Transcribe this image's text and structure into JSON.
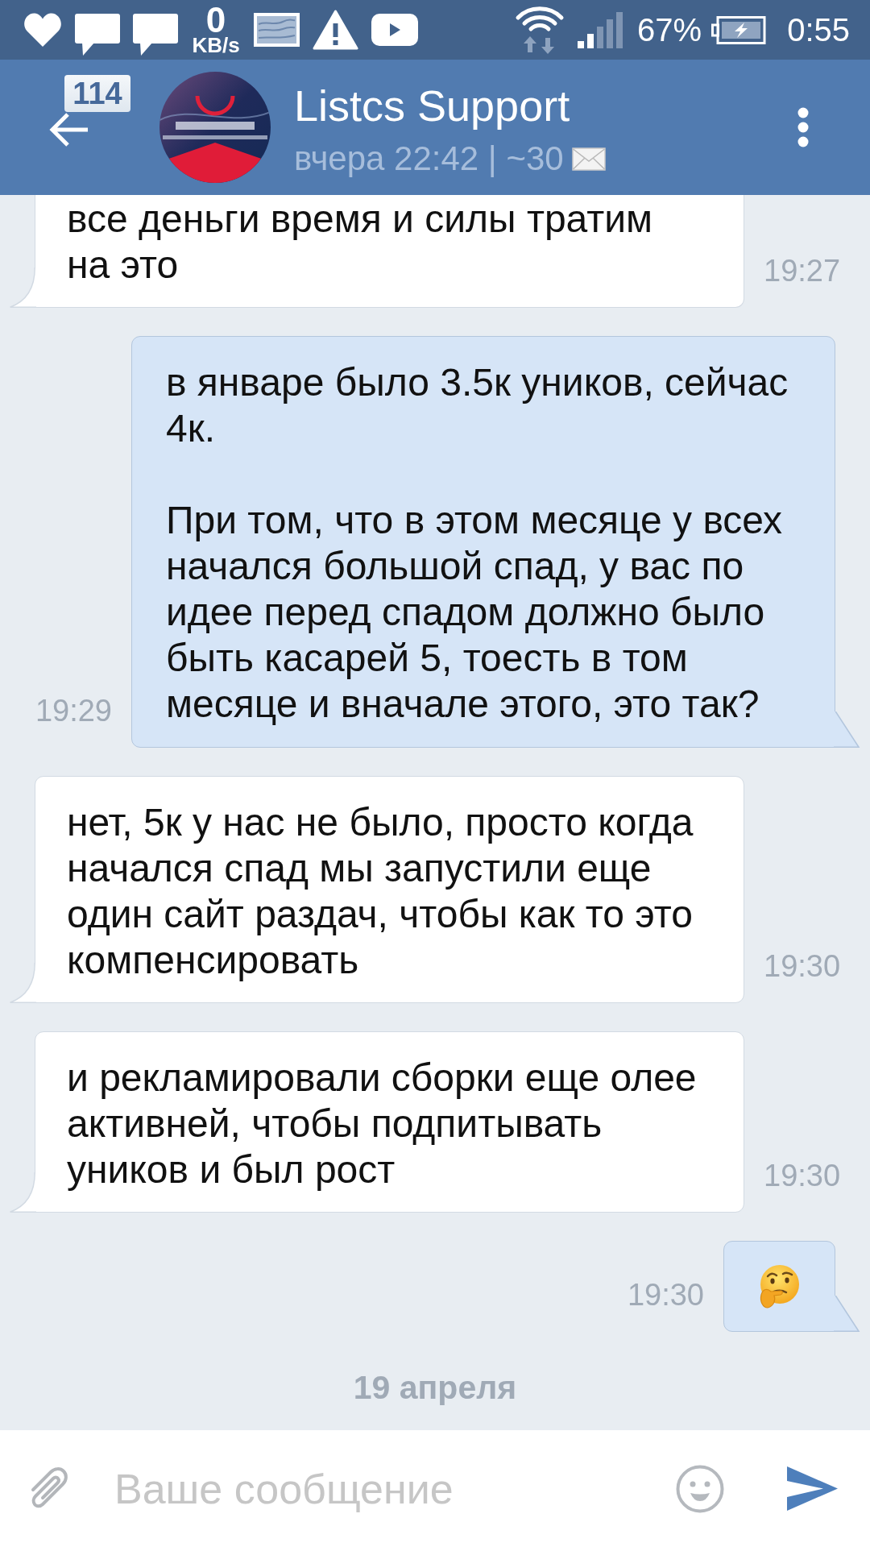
{
  "status_bar": {
    "net_speed_value": "0",
    "net_speed_unit": "KB/s",
    "battery": "67%",
    "time": "0:55"
  },
  "header": {
    "unread_badge": "114",
    "title": "Listcs Support",
    "subtitle": "вчера 22:42 | ~30"
  },
  "messages": [
    {
      "outgoing": false,
      "kind": "text",
      "paragraphs": [
        "все деньги время и силы тратим на это"
      ],
      "time": "19:27"
    },
    {
      "outgoing": true,
      "kind": "text",
      "paragraphs": [
        "в январе было 3.5к уников, сейчас 4к.",
        "При том, что в этом месяце у всех начался большой спад, у вас по идее перед спадом должно было быть касарей 5, тоесть в том месяце и вначале этого, это так?"
      ],
      "time": "19:29"
    },
    {
      "outgoing": false,
      "kind": "text",
      "paragraphs": [
        "нет, 5к у нас не было, просто когда начался спад мы запустили еще один сайт раздач, чтобы как то это компенсировать"
      ],
      "time": "19:30"
    },
    {
      "outgoing": false,
      "kind": "text",
      "paragraphs": [
        "и рекламировали сборки еще олее активней, чтобы подпитывать уников и был рост"
      ],
      "time": "19:30"
    },
    {
      "outgoing": true,
      "kind": "emoji",
      "time": "19:30"
    }
  ],
  "date_separator": "19 апреля",
  "composer": {
    "placeholder": "Ваше сообщение"
  }
}
